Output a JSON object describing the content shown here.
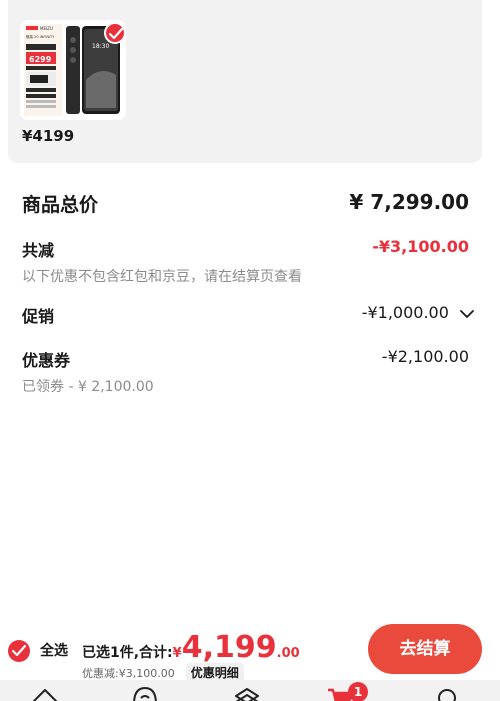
{
  "product": {
    "price": "¥4199",
    "thumb_brand": "MEIZU",
    "thumb_model": "魅族 20 INFINITY",
    "thumb_price": "6299",
    "thumb_time": "18:30"
  },
  "summary": {
    "total_label": "商品总价",
    "total_value": "¥ 7,299.00",
    "reduce_label": "共减",
    "reduce_value": "-¥3,100.00",
    "reduce_note": "以下优惠不包含红包和京豆，请在结算页查看",
    "promo_label": "促销",
    "promo_value": "-¥1,000.00",
    "coupon_label": "优惠券",
    "coupon_value": "-¥2,100.00",
    "coupon_note": "已领券 - ¥ 2,100.00"
  },
  "bottom": {
    "select_all": "全选",
    "selected_text": "已选1件,合计:",
    "currency": "¥",
    "amount_int": "4,199",
    "amount_dec": ".00",
    "discount_text": "优惠减:¥3,100.00",
    "detail_label": "优惠明细",
    "checkout_label": "去结算"
  },
  "tabbar": {
    "cart_badge": "1"
  },
  "colors": {
    "accent": "#e8313b",
    "checkout": "#ea4a3b"
  }
}
